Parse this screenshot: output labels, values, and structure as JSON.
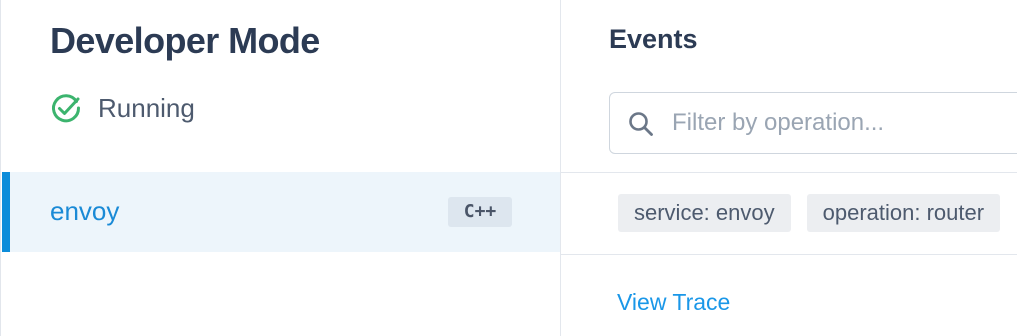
{
  "sidebar": {
    "app_title": "Developer Mode",
    "status": {
      "icon": "check-circle-icon",
      "color": "#3cb46e",
      "text": "Running"
    },
    "services": [
      {
        "name": "envoy",
        "language": "C++",
        "selected": true
      }
    ]
  },
  "main": {
    "title": "Events",
    "search": {
      "icon": "search-icon",
      "placeholder": "Filter by operation...",
      "value": ""
    },
    "event": {
      "tags": [
        "service: envoy",
        "operation: router"
      ],
      "view_trace_label": "View Trace"
    }
  },
  "colors": {
    "accent": "#0d8dda",
    "link": "#1a97e8",
    "selected_bg": "#edf5fb",
    "title": "#2c3b54",
    "status_ok": "#3cb46e"
  }
}
